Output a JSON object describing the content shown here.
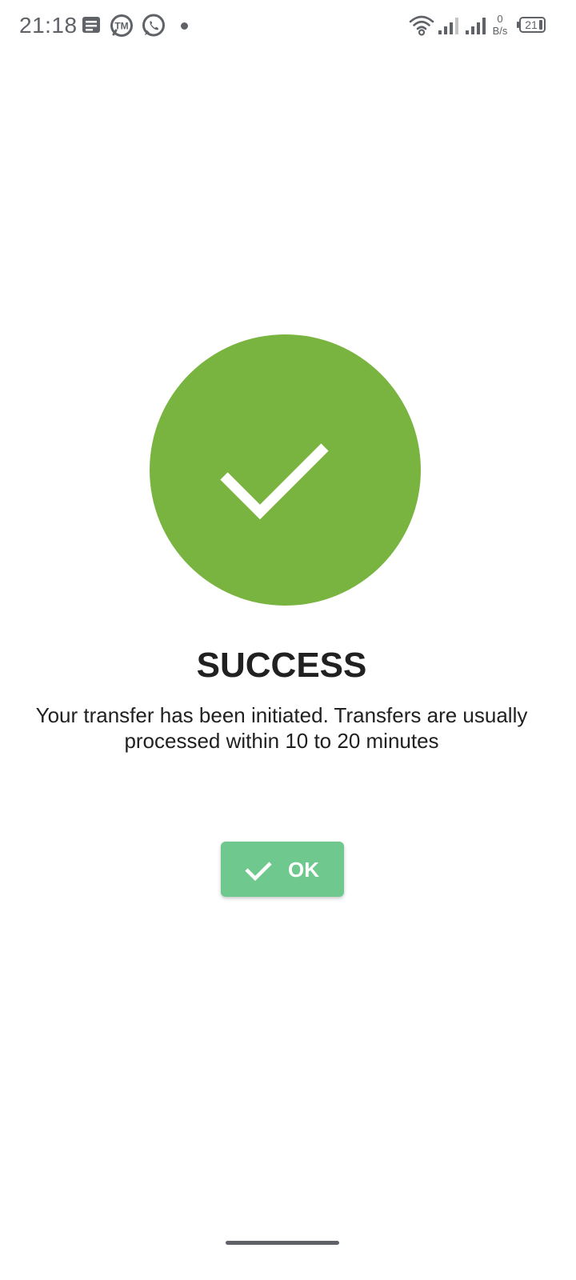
{
  "status_bar": {
    "time": "21:18",
    "net_speed_value": "0",
    "net_speed_unit": "B/s",
    "battery_level": "21",
    "icons": [
      "message-icon",
      "tm-icon",
      "whatsapp-icon",
      "notification-dot",
      "wifi-icon",
      "signal-sim1-icon",
      "signal-sim2-icon",
      "battery-icon"
    ]
  },
  "success": {
    "title": "SUCCESS",
    "message": "Your transfer has been initiated. Transfers are usually processed within 10 to 20 minutes",
    "icon": "check-icon"
  },
  "ok_button": {
    "label": "OK",
    "icon": "check-icon"
  },
  "colors": {
    "success_green": "#7ab440",
    "button_green": "#6fc98f",
    "text": "#212121",
    "status_icons": "#5f6368"
  }
}
